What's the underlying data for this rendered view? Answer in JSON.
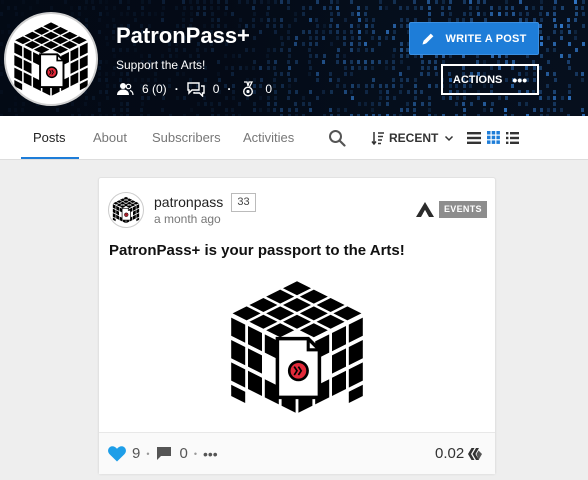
{
  "community": {
    "title": "PatronPass+",
    "subtitle": "Support the Arts!",
    "subscribers": "6 (0)",
    "posts": "0",
    "badges": "0",
    "write_post_label": "WRITE A POST",
    "actions_label": "ACTIONS"
  },
  "tabs": [
    {
      "label": "Posts",
      "active": true
    },
    {
      "label": "About",
      "active": false
    },
    {
      "label": "Subscribers",
      "active": false
    },
    {
      "label": "Activities",
      "active": false
    }
  ],
  "sort": {
    "label": "RECENT"
  },
  "post": {
    "author": "patronpass",
    "reputation": "33",
    "time": "a month ago",
    "tag": "EVENTS",
    "title": "PatronPass+ is your passport to the Arts!",
    "votes": "9",
    "comments": "0",
    "payout": "0.02"
  },
  "colors": {
    "accent": "#1e7dd8",
    "heart": "#1e9ee8",
    "logo_red": "#e32a3a",
    "tag_bg": "#8d8d8d"
  },
  "icons": [
    "users-icon",
    "chat-icon",
    "medal-icon",
    "pen-icon",
    "ellipsis-icon",
    "search-icon",
    "sort-icon",
    "chevron-down-icon",
    "list-icon",
    "grid-icon",
    "compact-list-icon",
    "app-icon",
    "heart-icon",
    "comment-icon",
    "hive-icon"
  ]
}
